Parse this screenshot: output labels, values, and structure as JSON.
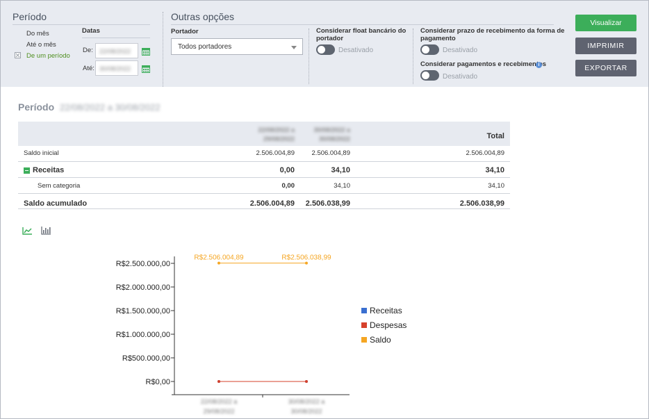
{
  "filters": {
    "periodo_title": "Período",
    "period_options": [
      "Do mês",
      "Até o mês",
      "De um período"
    ],
    "datas_label": "Datas",
    "de_label": "De:",
    "ate_label": "Até:",
    "de_value": "22/08/2022",
    "ate_value": "30/08/2022"
  },
  "outras": {
    "title": "Outras opções",
    "portador_label": "Portador",
    "portador_value": "Todos portadores",
    "float_label_1": "Considerar float bancário do",
    "float_label_2": "portador",
    "float_state": "Desativado",
    "prazo_label_1": "Considerar prazo de recebimento da forma de",
    "prazo_label_2": "pagamento",
    "prazo_state": "Desativado",
    "pagamentos_label": "Considerar pagamentos e recebimentos",
    "pagamentos_state": "Desativado"
  },
  "buttons": {
    "visualizar": "Visualizar",
    "imprimir": "IMPRIMIR",
    "exportar": "EXPORTAR"
  },
  "report": {
    "periodo_label": "Período",
    "periodo_range": "22/08/2022 a 30/08/2022",
    "col1_line1": "22/08/2022 a",
    "col1_line2": "29/08/2022",
    "col2_line1": "30/08/2022 a",
    "col2_line2": "30/08/2022",
    "col_total": "Total",
    "rows": [
      {
        "label": "Saldo inicial",
        "c1": "2.506.004,89",
        "c2": "2.506.004,89",
        "total": "2.506.004,89"
      },
      {
        "label": "Receitas",
        "c1": "0,00",
        "c2": "34,10",
        "total": "34,10"
      },
      {
        "label": "Sem categoria",
        "c1": "0,00",
        "c2": "34,10",
        "total": "34,10"
      },
      {
        "label": "Saldo acumulado",
        "c1": "2.506.004,89",
        "c2": "2.506.038,99",
        "total": "2.506.038,99"
      }
    ]
  },
  "chart_data": {
    "type": "line",
    "x": [
      "22/08/2022 a 29/08/2022",
      "30/08/2022 a 30/08/2022"
    ],
    "series": [
      {
        "name": "Receitas",
        "color": "#3a6fd0",
        "values": [
          0,
          34.1
        ]
      },
      {
        "name": "Despesas",
        "color": "#d6412b",
        "values": [
          0,
          0
        ]
      },
      {
        "name": "Saldo",
        "color": "#f5a623",
        "values": [
          2506004.89,
          2506038.99
        ]
      }
    ],
    "data_labels": [
      "R$2.506.004,89",
      "R$2.506.038,99"
    ],
    "y_ticks": [
      "R$0,00",
      "R$500.000,00",
      "R$1.000.000,00",
      "R$1.500.000,00",
      "R$2.000.000,00",
      "R$2.500.000,00"
    ],
    "ylim": [
      0,
      2500000
    ],
    "legend_position": "right"
  },
  "chart_toggles": [
    "line-chart-icon",
    "bar-chart-icon"
  ]
}
